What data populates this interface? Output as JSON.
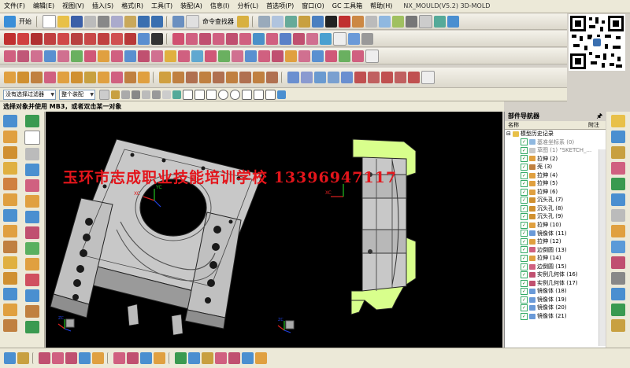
{
  "menu": {
    "items": [
      "文件(F)",
      "编辑(E)",
      "视图(V)",
      "插入(S)",
      "格式(R)",
      "工具(T)",
      "装配(A)",
      "信息(I)",
      "分析(L)",
      "首选项(P)",
      "窗口(O)",
      "GC 工具箱",
      "帮助(H)"
    ],
    "app_title": "NX_MOULD(V5.2)   3D-MOLD"
  },
  "toolbar": {
    "start_label": "开始",
    "command_finder_label": "命令查找器"
  },
  "selection_bar": {
    "filter_value": "没有选择过滤器",
    "scope_value": "整个装配"
  },
  "cue_line": "选择对象并使用 MB3，或者双击某一对象",
  "watermark": "玉环市志成职业技能培训学校  13396947117",
  "navigator": {
    "title": "部件导航器",
    "col_name": "名称",
    "col_status": "附注",
    "root": "模型历史记录",
    "items": [
      "基准坐标系 (0)",
      "草图 (1) \"SKETCH_...",
      "拉伸 (2)",
      "壳 (3)",
      "拉伸 (4)",
      "拉伸 (5)",
      "拉伸 (6)",
      "沉头孔 (7)",
      "沉头孔 (8)",
      "沉头孔 (9)",
      "拉伸 (10)",
      "镜像体 (11)",
      "拉伸 (12)",
      "边倒圆 (13)",
      "拉伸 (14)",
      "边倒圆 (15)",
      "实例几何体 (16)",
      "实例几何体 (17)",
      "镜像体 (18)",
      "镜像体 (19)",
      "镜像体 (20)",
      "镜像体 (21)"
    ]
  },
  "triad": {
    "xc": "XC",
    "yc": "YC",
    "zc": "ZC"
  },
  "colors": {
    "section_fill": "#d8ff8c",
    "body_fill": "#c8c8c8",
    "watermark": "#e4151b",
    "background": "#000000"
  }
}
